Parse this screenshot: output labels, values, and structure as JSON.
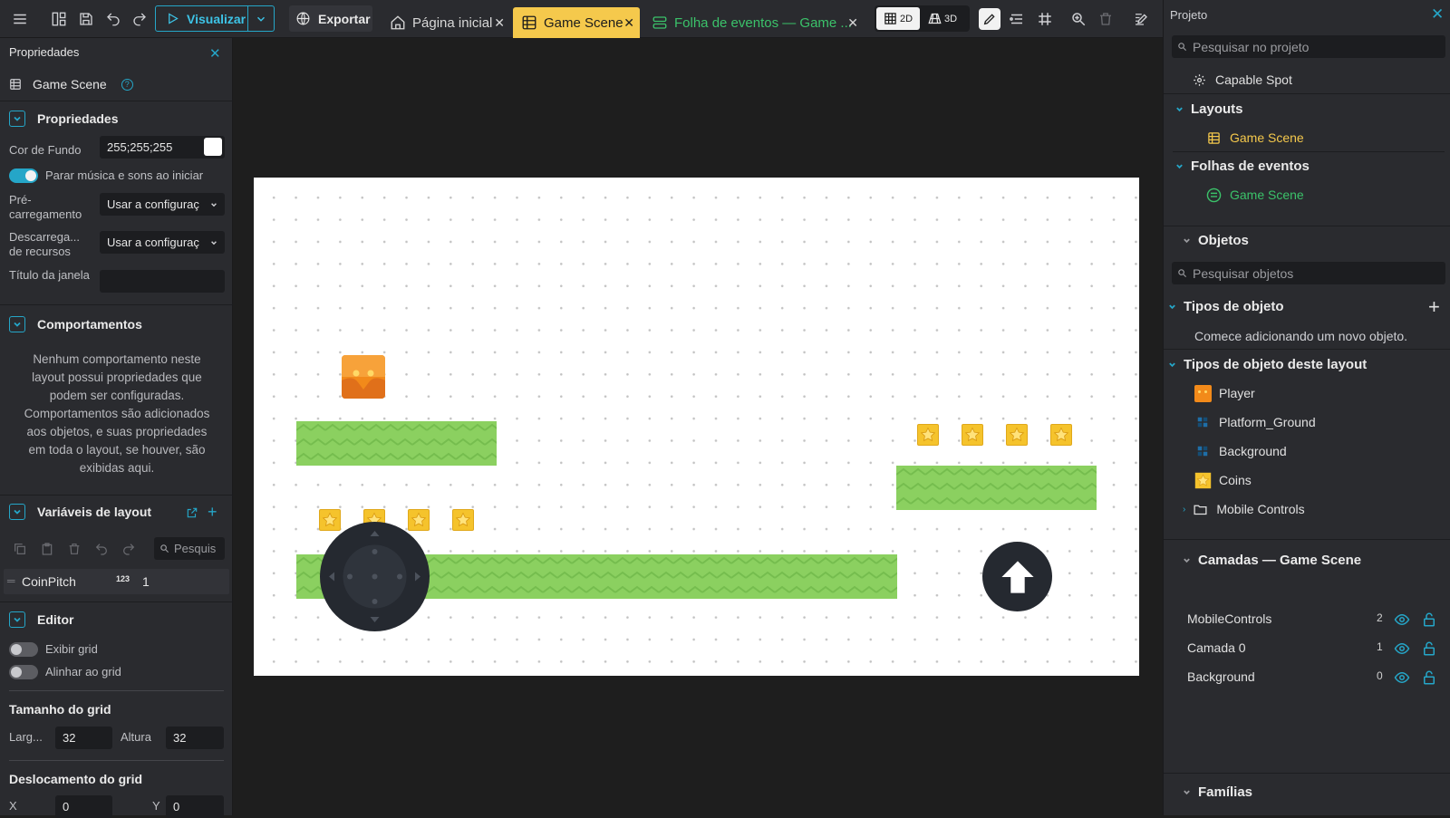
{
  "toolbar": {
    "visualizar": "Visualizar",
    "exportar": "Exportar",
    "view_2d": "2D",
    "view_3d": "3D"
  },
  "tabs": [
    {
      "label": "Página inicial"
    },
    {
      "label": "Game Scene"
    },
    {
      "label": "Folha de eventos — Game ..."
    }
  ],
  "left_panel": {
    "title": "Propriedades",
    "scene_name": "Game Scene",
    "propriedades": {
      "header": "Propriedades",
      "bg_color_label": "Cor de Fundo",
      "bg_color_value": "255;255;255",
      "stop_music_label": "Parar música e sons ao iniciar",
      "stop_music_on": true,
      "preload_label": "Pré-carregamento",
      "preload_value": "Usar a configuraç",
      "unload_label": "Descarrega... de recursos",
      "unload_value": "Usar a configuraç",
      "window_title_label": "Título da janela",
      "window_title_value": ""
    },
    "comportamentos": {
      "header": "Comportamentos",
      "empty_text": "Nenhum comportamento neste layout possui propriedades que podem ser configuradas. Comportamentos são adicionados aos objetos, e suas propriedades em toda o layout, se houver, são exibidas aqui."
    },
    "variaveis": {
      "header": "Variáveis de layout",
      "search_placeholder": "Pesquis",
      "items": [
        {
          "name": "CoinPitch",
          "type_icon": "123",
          "value": "1"
        }
      ]
    },
    "editor": {
      "header": "Editor",
      "show_grid_label": "Exibir grid",
      "show_grid_on": false,
      "snap_grid_label": "Alinhar ao grid",
      "snap_grid_on": false,
      "grid_size_header": "Tamanho do grid",
      "width_label": "Larg...",
      "width_value": "32",
      "height_label": "Altura",
      "height_value": "32",
      "grid_offset_header": "Deslocamento do grid",
      "x_label": "X",
      "x_value": "0",
      "y_label": "Y",
      "y_value": "0"
    }
  },
  "right_panel": {
    "title": "Projeto",
    "search_placeholder": "Pesquisar no projeto",
    "project_name": "Capable Spot",
    "layouts_header": "Layouts",
    "layouts": [
      "Game Scene"
    ],
    "events_header": "Folhas de eventos",
    "events": [
      "Game Scene"
    ],
    "objects_header": "Objetos",
    "objects_search_placeholder": "Pesquisar objetos",
    "object_types_header": "Tipos de objeto",
    "object_types_empty": "Comece adicionando um novo objeto.",
    "layout_object_types_header": "Tipos de objeto deste layout",
    "layout_objects": [
      {
        "name": "Player",
        "icon": "player-icon"
      },
      {
        "name": "Platform_Ground",
        "icon": "tiled-sprite-icon"
      },
      {
        "name": "Background",
        "icon": "tiled-sprite-icon"
      },
      {
        "name": "Coins",
        "icon": "coin-icon"
      },
      {
        "name": "Mobile Controls",
        "icon": "folder-icon"
      }
    ],
    "layers_header": "Camadas — Game Scene",
    "layers": [
      {
        "name": "MobileControls",
        "index": "2"
      },
      {
        "name": "Camada 0",
        "index": "1"
      },
      {
        "name": "Background",
        "index": "0"
      }
    ],
    "families_header": "Famílias"
  },
  "colors": {
    "accent": "#25a6c8",
    "active_tab": "#f5c94c",
    "events_tab": "#3bc26a",
    "platform": "#8bd060",
    "coin": "#f5c32c",
    "player": "#f28a1a",
    "panel_bg": "#2a2b2f"
  }
}
